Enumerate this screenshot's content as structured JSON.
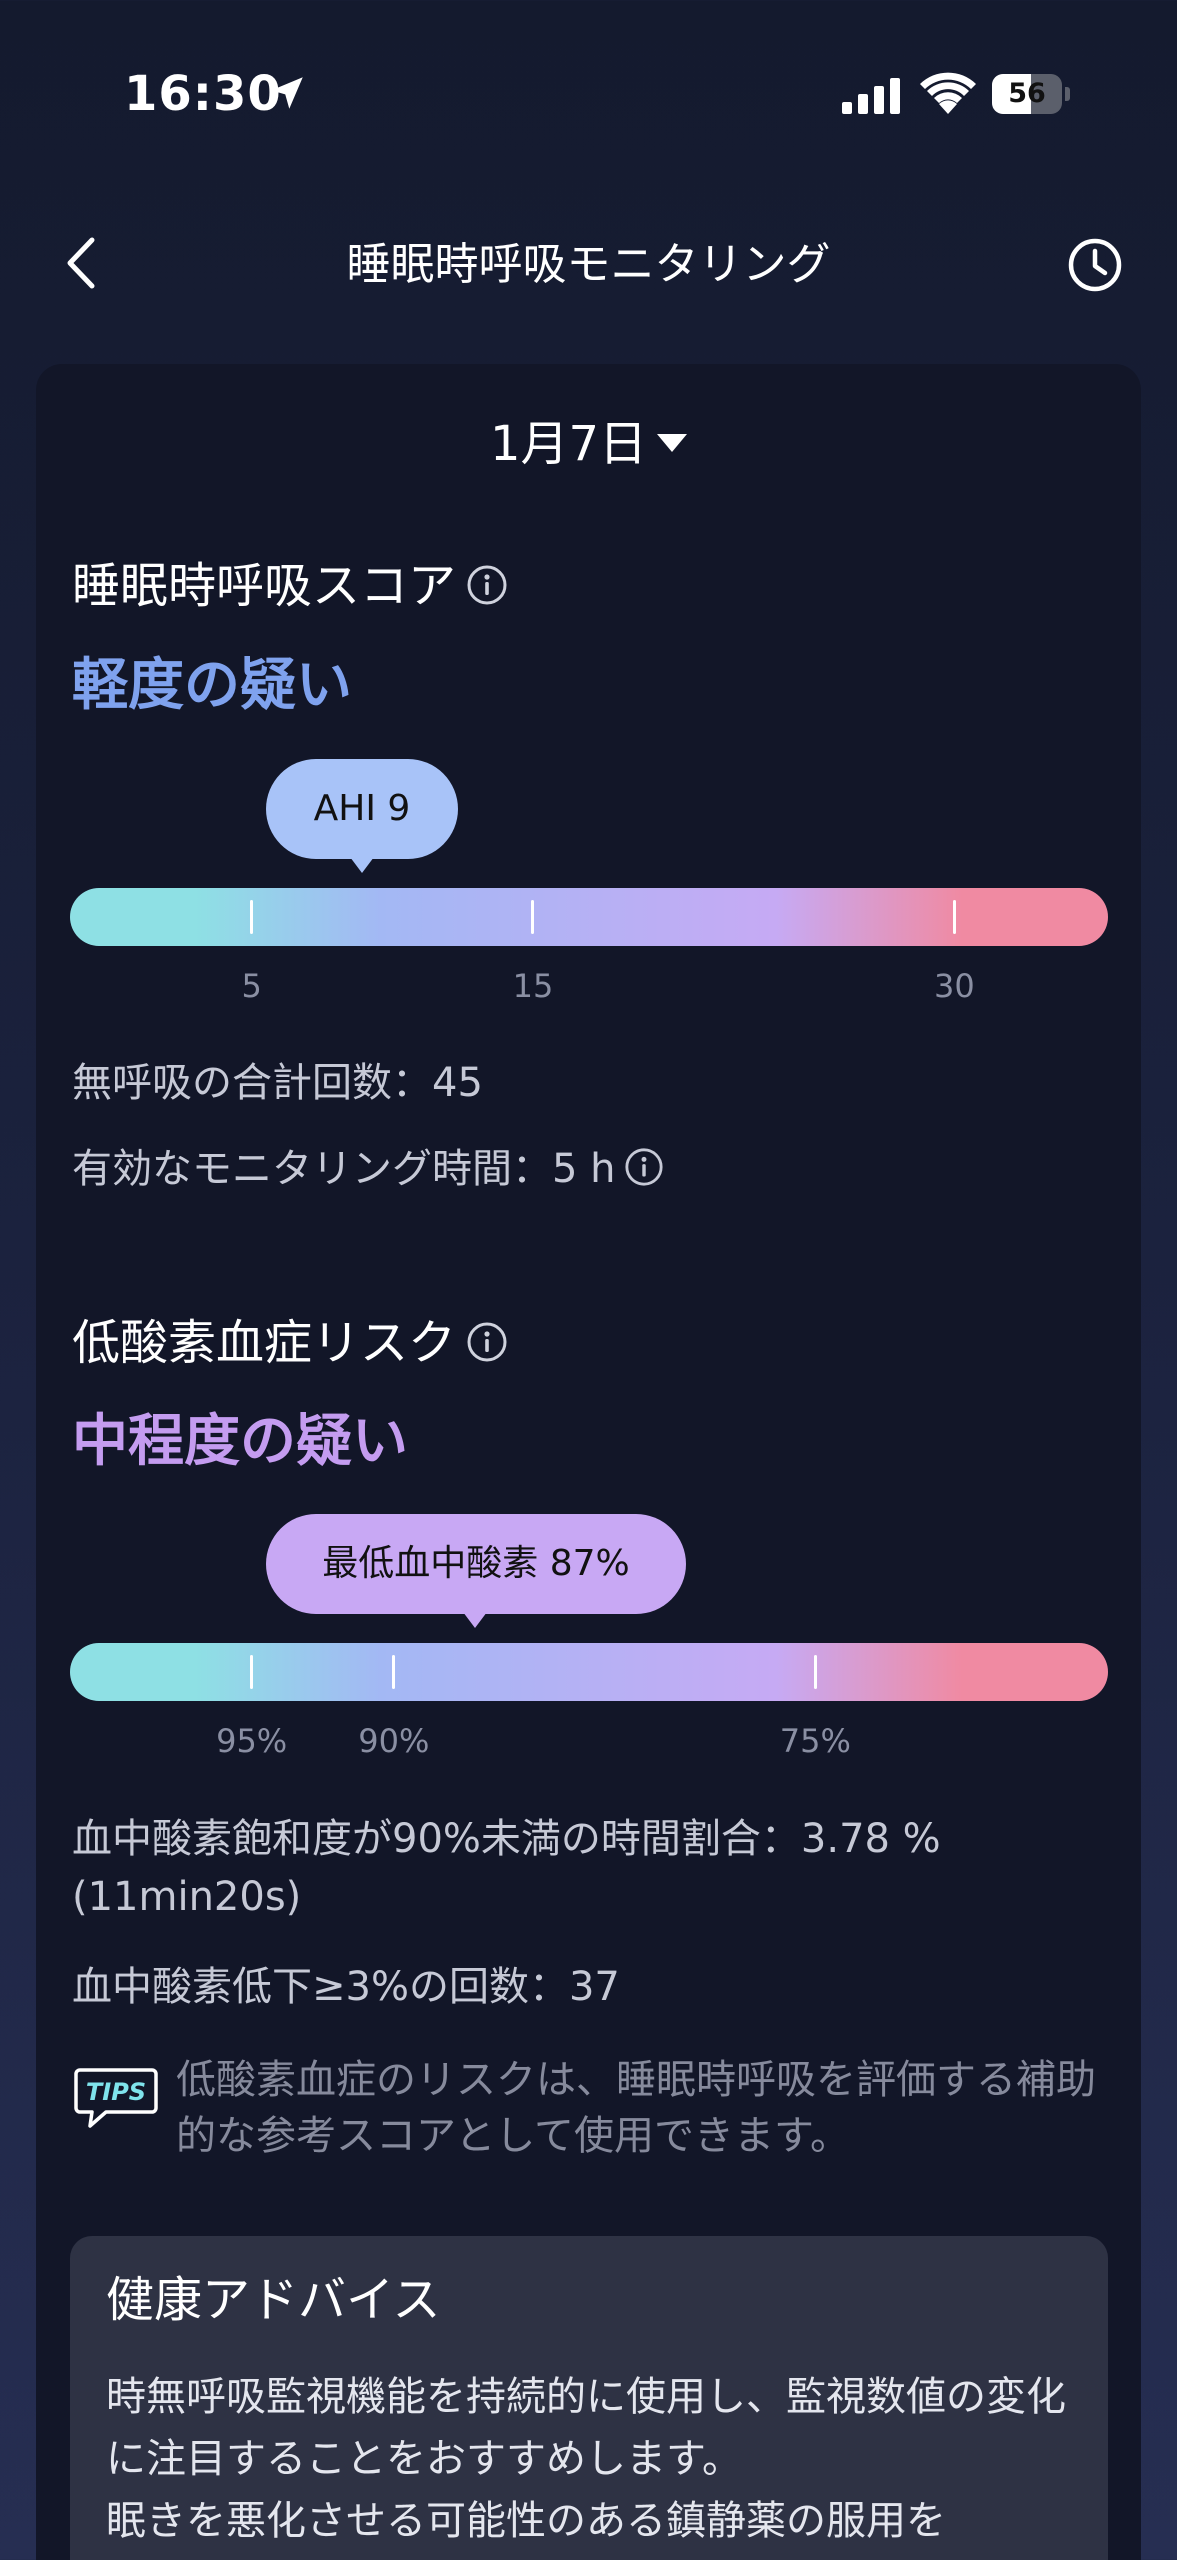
{
  "status_bar": {
    "time": "16:30",
    "battery": "56",
    "battery_level_percent": 56
  },
  "header": {
    "title": "睡眠時呼吸モニタリング",
    "back_icon": "chevron-left-icon",
    "history_icon": "clock-icon"
  },
  "date_selector": {
    "label": "1月7日"
  },
  "apnea": {
    "title": "睡眠時呼吸スコア",
    "level": "軽度の疑い",
    "level_color": "#7fa2ee",
    "bubble": "AHI 9",
    "bubble_color": "#a8c3f8",
    "ticks": [
      {
        "label": "5",
        "position_percent": 17.5
      },
      {
        "label": "15",
        "position_percent": 44.6
      },
      {
        "label": "30",
        "position_percent": 85.2
      }
    ],
    "indicator_position_percent": 28.1,
    "stat1": "無呼吸の合計回数：45",
    "stat2": "有効なモニタリング時間：5 h"
  },
  "hypoxemia": {
    "title": "低酸素血症リスク",
    "level": "中程度の疑い",
    "level_color": "#c49cf0",
    "bubble": "最低血中酸素 87%",
    "bubble_color": "#c8a8f4",
    "ticks": [
      {
        "label": "95%",
        "position_percent": 17.5
      },
      {
        "label": "90%",
        "position_percent": 31.2
      },
      {
        "label": "75%",
        "position_percent": 71.8
      }
    ],
    "indicator_position_percent": 39.0,
    "stat1": "血中酸素飽和度が90%未満の時間割合：3.78 %",
    "stat1_sub": "(11min20s)",
    "stat2": "血中酸素低下≥3%の回数：37"
  },
  "tips": {
    "icon_label": "TIPS",
    "text": "低酸素血症のリスクは、睡眠時呼吸を評価する補助的な参考スコアとして使用できます。"
  },
  "advice": {
    "title": "健康アドバイス",
    "line1": "時無呼吸監視機能を持続的に使用し、監視数値の変化に注目することをおすすめします。",
    "line2": "眠きを悪化させる可能性のある鎮静薬の服用を"
  },
  "colors": {
    "bar_gradient": [
      "#8ee0e4",
      "#a3b8f4",
      "#c6aaf4",
      "#f08aa2"
    ],
    "card_bg": "#121628"
  }
}
